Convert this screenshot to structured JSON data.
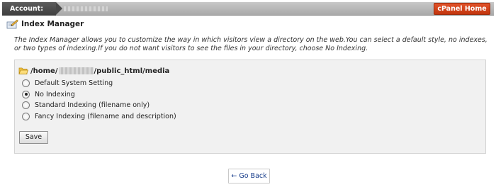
{
  "topbar": {
    "account_label": "Account:",
    "cpanel_home_label": "cPanel Home",
    "accent_color": "#d2451c"
  },
  "header": {
    "icon": "index-manager-icon",
    "title": "Index Manager"
  },
  "intro": {
    "text": "The Index Manager allows you to customize the way in which visitors view a directory on the web.You can select a default style, no indexes, or two types of indexing.If you do not want visitors to see the files in your directory, choose No Indexing."
  },
  "directory": {
    "icon": "folder-open-icon",
    "path_prefix": "/home/",
    "path_suffix": "/public_html/media"
  },
  "options": [
    {
      "label": "Default System Setting",
      "checked": false
    },
    {
      "label": "No Indexing",
      "checked": true
    },
    {
      "label": "Standard Indexing (filename only)",
      "checked": false
    },
    {
      "label": "Fancy Indexing (filename and description)",
      "checked": false
    }
  ],
  "form": {
    "save_label": "Save"
  },
  "footer": {
    "go_back_label": "← Go Back"
  }
}
